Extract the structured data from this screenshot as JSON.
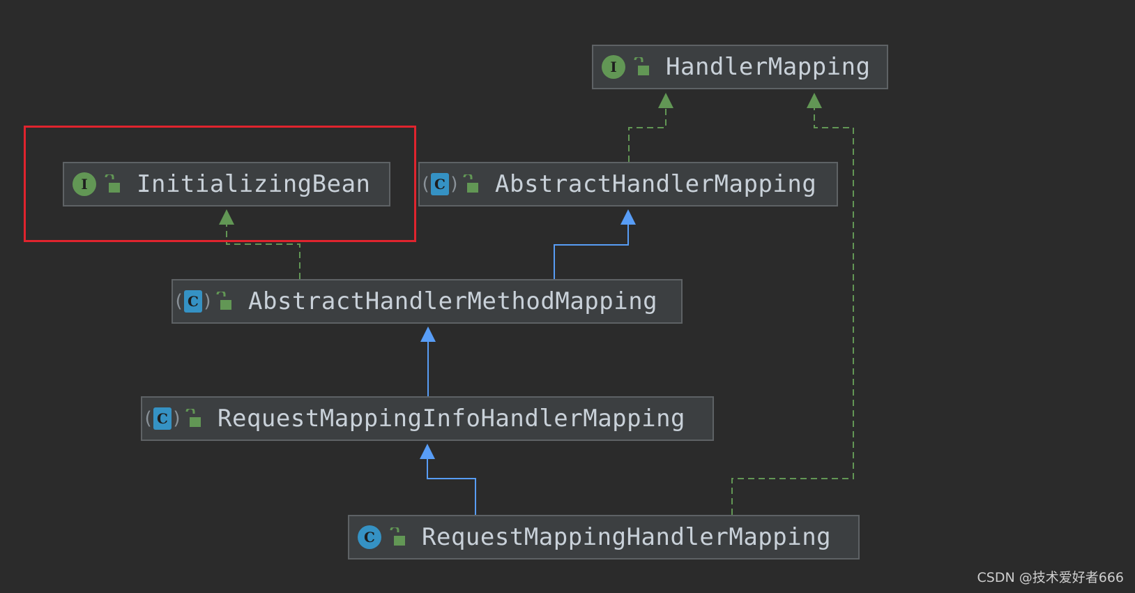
{
  "diagram": {
    "nodes": {
      "handler_mapping": {
        "label": "HandlerMapping",
        "kind": "interface",
        "badge_letter": "I"
      },
      "initializing_bean": {
        "label": "InitializingBean",
        "kind": "interface",
        "badge_letter": "I"
      },
      "abstract_handler_mapping": {
        "label": "AbstractHandlerMapping",
        "kind": "abstract-class",
        "badge_letter": "C"
      },
      "abstract_handler_method_mapping": {
        "label": "AbstractHandlerMethodMapping",
        "kind": "abstract-class",
        "badge_letter": "C"
      },
      "request_mapping_info_handler_mapping": {
        "label": "RequestMappingInfoHandlerMapping",
        "kind": "abstract-class",
        "badge_letter": "C"
      },
      "request_mapping_handler_mapping": {
        "label": "RequestMappingHandlerMapping",
        "kind": "class",
        "badge_letter": "C"
      }
    },
    "edges": [
      {
        "from": "abstract_handler_mapping",
        "to": "handler_mapping",
        "type": "implements"
      },
      {
        "from": "request_mapping_handler_mapping",
        "to": "handler_mapping",
        "type": "implements"
      },
      {
        "from": "abstract_handler_method_mapping",
        "to": "initializing_bean",
        "type": "implements"
      },
      {
        "from": "abstract_handler_method_mapping",
        "to": "abstract_handler_mapping",
        "type": "extends"
      },
      {
        "from": "request_mapping_info_handler_mapping",
        "to": "abstract_handler_method_mapping",
        "type": "extends"
      },
      {
        "from": "request_mapping_handler_mapping",
        "to": "request_mapping_info_handler_mapping",
        "type": "extends"
      }
    ],
    "highlighted_node": "initializing_bean"
  },
  "colors": {
    "background": "#2b2b2b",
    "node_fill": "#3c3f41",
    "interface_badge": "#629755",
    "class_badge": "#3592c4",
    "implements_edge": "#629755",
    "extends_edge": "#589df6",
    "highlight": "#e0242e"
  },
  "watermark": "CSDN @技术爱好者666"
}
